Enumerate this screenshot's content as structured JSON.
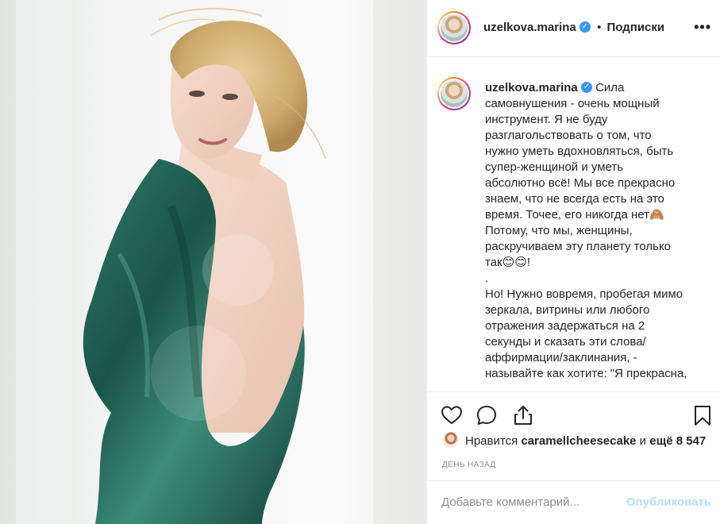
{
  "post": {
    "username": "uzelkova.marina",
    "verified_mark": "✓",
    "separator": "•",
    "follow_label": "Подписки",
    "more_label": "•••",
    "caption_lines": [
      "Сила",
      "самовнушения - очень мощный",
      "инструмент. Я не буду",
      "разглагольствовать о том, что",
      "нужно уметь вдохновляться, быть",
      "супер-женщиной и уметь",
      "абсолютно всё! Мы все прекрасно",
      "знаем, что не всегда есть на это",
      "время. Точее, его никогда нет🙈",
      "Потому, что мы, женщины,",
      "раскручиваем эту планету только",
      "так😊😊!",
      ".",
      "Но! Нужно вовремя, пробегая мимо",
      "зеркала, витрины или любого",
      "отражения задержаться на 2",
      "секунды и сказать эти слова/",
      "аффирмации/заклинания, -",
      "называйте как хотите: \"Я прекрасна,"
    ],
    "likes": {
      "prefix": "Нравится",
      "user": "caramellcheesecake",
      "middle": "и",
      "count": "ещё 8 547"
    },
    "date": "ДЕНЬ НАЗАД",
    "comment_placeholder": "Добавьте комментарий...",
    "publish_label": "Опубликовать"
  },
  "icons": [
    "heart-icon",
    "comment-icon",
    "share-icon",
    "bookmark-icon",
    "verified-icon",
    "more-icon"
  ],
  "colors": {
    "text": "#262626",
    "muted": "#8e8e8e",
    "verified": "#3897f0",
    "publish_disabled": "#b2dffc",
    "border": "#efefef",
    "dress": "#1f5a4e"
  }
}
